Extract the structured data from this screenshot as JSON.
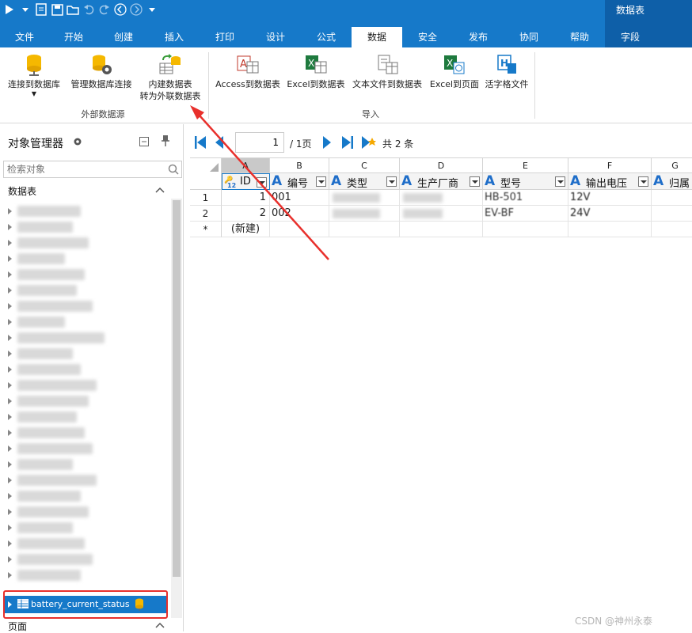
{
  "ribbon_tabs": [
    "文件",
    "开始",
    "创建",
    "插入",
    "打印",
    "设计",
    "公式",
    "数据",
    "安全",
    "发布",
    "协同",
    "帮助",
    "字段"
  ],
  "active_tab": "数据",
  "context_tab_header": "数据表",
  "ribbon": {
    "external_group_label": "外部数据源",
    "import_group_label": "导入",
    "buttons": {
      "connect_db": "连接到数据库",
      "manage_db": "管理数据库连接",
      "convert_line1": "内建数据表",
      "convert_line2": "转为外联数据表",
      "access": "Access到数据表",
      "excel_table": "Excel到数据表",
      "text_file": "文本文件到数据表",
      "excel_page": "Excel到页面",
      "live_grid": "活字格文件"
    }
  },
  "left_panel": {
    "title": "对象管理器",
    "search_placeholder": "检索对象",
    "section_tables": "数据表",
    "selected_table": "battery_current_status",
    "section_pages": "页面"
  },
  "navigator": {
    "current_page": "1",
    "total_pages": "/ 1页",
    "record_count": "共 2 条"
  },
  "grid": {
    "column_letters": [
      "A",
      "B",
      "C",
      "D",
      "E",
      "F",
      "G"
    ],
    "fields": [
      "ID",
      "编号",
      "类型",
      "生产厂商",
      "型号",
      "输出电压",
      "归属"
    ],
    "rows": [
      {
        "num": "1",
        "id": "1",
        "code": "001",
        "model": "HB-501",
        "voltage": "12V"
      },
      {
        "num": "2",
        "id": "2",
        "code": "002",
        "model": "EV-BF",
        "voltage": "24V"
      }
    ],
    "new_row_marker": "*",
    "new_row_label": "(新建)"
  },
  "watermark": "CSDN @神州永泰",
  "colors": {
    "brand_blue": "#1679c9",
    "highlight_red": "#e8302c",
    "field_letter_blue": "#1f6ec9"
  }
}
